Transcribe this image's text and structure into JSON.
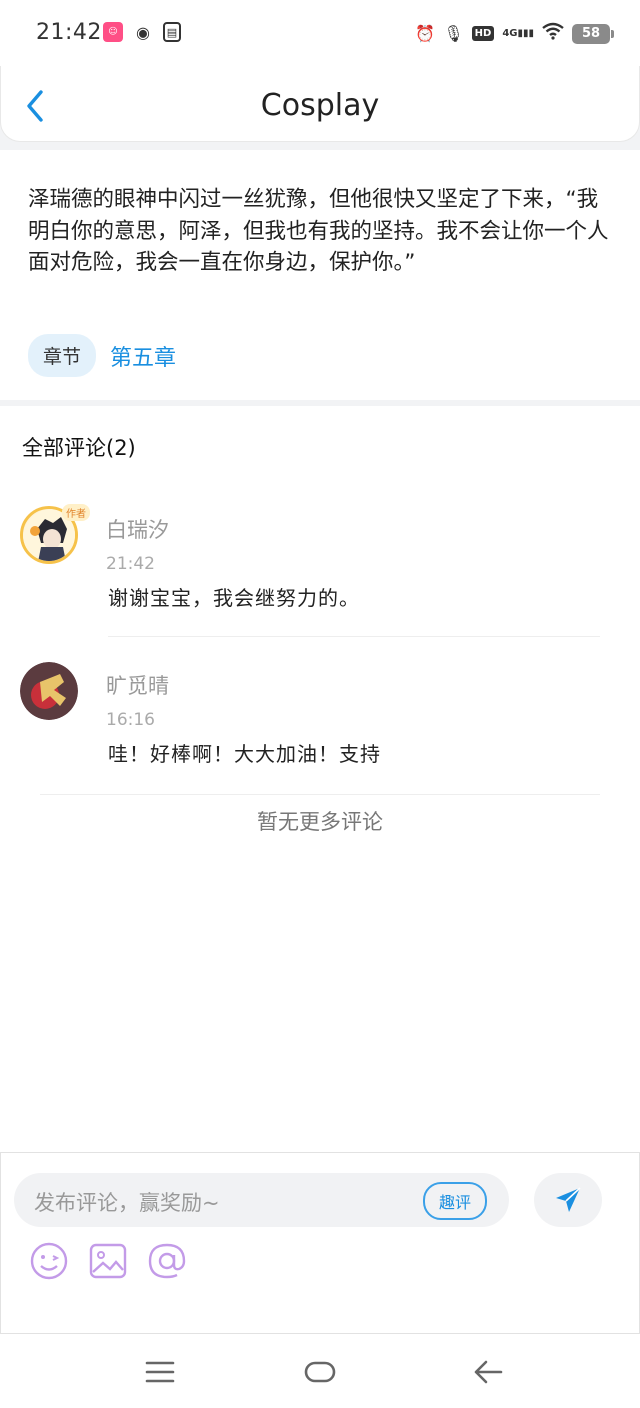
{
  "status_bar": {
    "time": "21:42",
    "network": "4G",
    "hd": "HD",
    "battery": "58"
  },
  "header": {
    "title": "Cosplay"
  },
  "post": {
    "excerpt": "泽瑞德的眼神中闪过一丝犹豫，但他很快又坚定了下来，“我明白你的意思，阿泽，但我也有我的坚持。我不会让你一个人面对危险，我会一直在你身边，保护你。”",
    "chapter_tag": "章节",
    "chapter_link": "第五章"
  },
  "comments": {
    "title": "全部评论(2)",
    "items": [
      {
        "author": "白瑞汐",
        "badge": "作者",
        "time": "21:42",
        "text": "谢谢宝宝，我会继努力的。"
      },
      {
        "author": "旷觅晴",
        "time": "16:16",
        "text": "哇！好棒啊！大大加油！支持"
      }
    ],
    "no_more": "暂无更多评论"
  },
  "input": {
    "placeholder": "发布评论，赢奖励~",
    "qu_ping": "趣评"
  },
  "colors": {
    "accent": "#1a8fe0",
    "tag_bg": "#e3f1fb",
    "tool_icon": "#c39be8"
  }
}
